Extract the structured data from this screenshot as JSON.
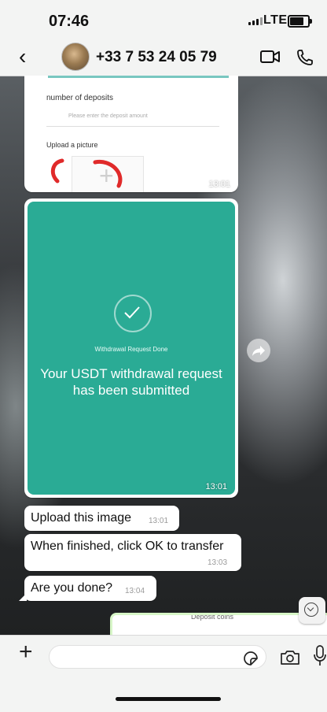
{
  "status_bar": {
    "time": "07:46",
    "network": "LTE"
  },
  "header": {
    "contact": "+33 7 53 24 05 79"
  },
  "image_form": {
    "deposits_label": "number of deposits",
    "deposit_placeholder": "Please enter the deposit amount",
    "upload_label": "Upload a picture",
    "time": "13:01"
  },
  "withdrawal_image": {
    "status": "Withdrawal Request Done",
    "message": "Your USDT withdrawal request has been submitted",
    "time": "13:01"
  },
  "messages": [
    {
      "text": "Upload this image",
      "time": "13:01"
    },
    {
      "text": "When finished, click OK to transfer",
      "time": "13:03"
    },
    {
      "text": "Are you done?",
      "time": "13:04"
    }
  ],
  "sent_preview": {
    "caption": "Deposit coins"
  },
  "composer": {
    "value": ""
  }
}
